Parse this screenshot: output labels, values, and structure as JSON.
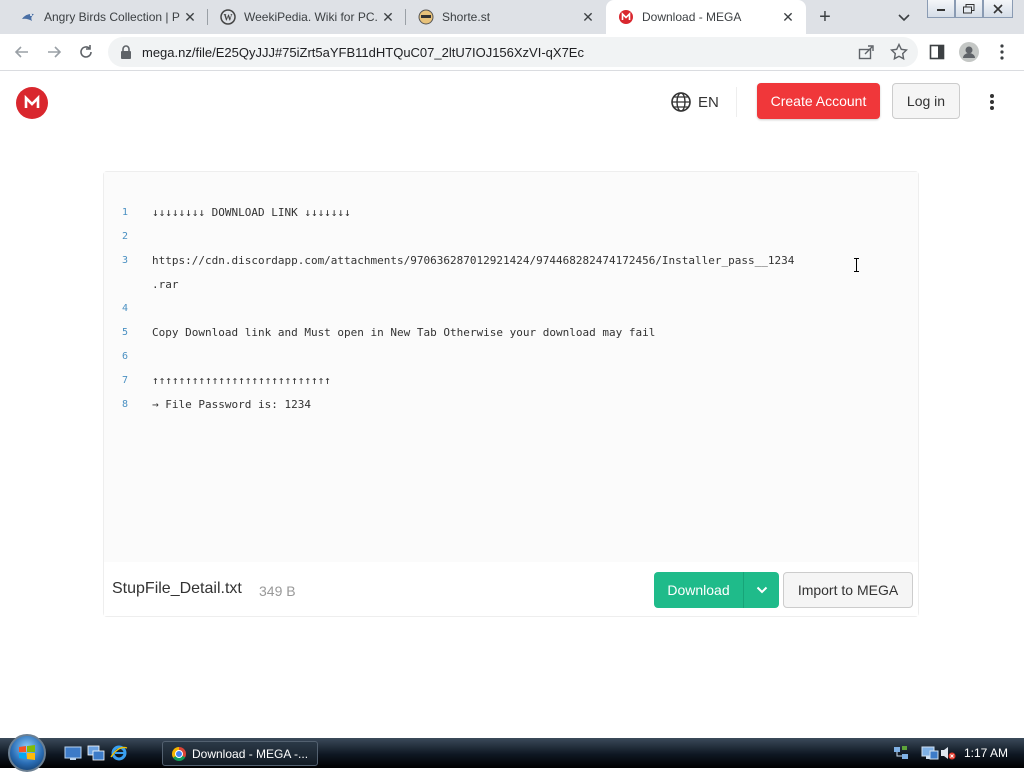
{
  "browser": {
    "tabs": [
      {
        "title": "Angry Birds Collection | P",
        "icon": "bird-icon",
        "active": false
      },
      {
        "title": "WeekiPedia. Wiki for PC.",
        "icon": "wordpress-icon",
        "active": false
      },
      {
        "title": "Shorte.st",
        "icon": "shortest-icon",
        "active": false
      },
      {
        "title": "Download - MEGA",
        "icon": "mega-icon",
        "active": true
      }
    ],
    "url": "mega.nz/file/E25QyJJJ#75iZrt5aYFB11dHTQuC07_2ltU7IOJ156XzVI-qX7Ec"
  },
  "header": {
    "lang": "EN",
    "create_account": "Create Account",
    "login": "Log in"
  },
  "preview": {
    "lines": [
      {
        "num": "1",
        "text": "↓↓↓↓↓↓↓↓ DOWNLOAD LINK ↓↓↓↓↓↓↓"
      },
      {
        "num": "2",
        "text": ""
      },
      {
        "num": "3",
        "text": "https://cdn.discordapp.com/attachments/970636287012921424/974468282474172456/Installer_pass__1234"
      },
      {
        "num": "",
        "text": ".rar"
      },
      {
        "num": "4",
        "text": ""
      },
      {
        "num": "5",
        "text": "Copy Download link and Must open in New Tab Otherwise your download may fail"
      },
      {
        "num": "6",
        "text": ""
      },
      {
        "num": "7",
        "text": "↑↑↑↑↑↑↑↑↑↑↑↑↑↑↑↑↑↑↑↑↑↑↑↑↑↑↑"
      },
      {
        "num": "8",
        "text": "→ File Password is: 1234"
      }
    ]
  },
  "file": {
    "name": "StupFile_Detail.txt",
    "size": "349 B",
    "download": "Download",
    "import": "Import to MEGA"
  },
  "taskbar": {
    "window": "Download - MEGA -...",
    "time": "1:17 AM"
  },
  "colors": {
    "mega_red": "#d9272e",
    "create_btn": "#f0373a",
    "download_btn": "#1fbb8a"
  }
}
